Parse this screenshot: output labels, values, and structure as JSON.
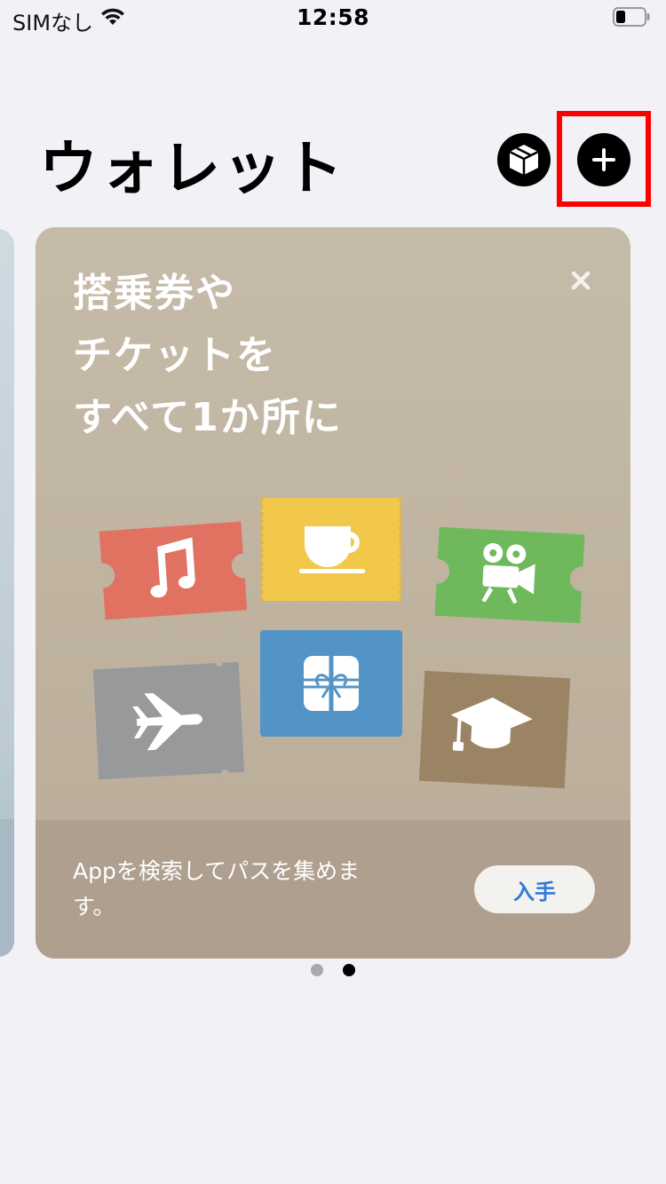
{
  "status_bar": {
    "carrier": "SIMなし",
    "time": "12:58",
    "wifi_icon": "wifi-icon",
    "battery_icon": "battery-low-icon"
  },
  "header": {
    "title": "ウォレット",
    "buttons": [
      {
        "name": "box-button",
        "icon": "package-icon"
      },
      {
        "name": "add-button",
        "icon": "plus-icon",
        "highlighted": true
      }
    ]
  },
  "promo_card": {
    "title": "搭乗券や\nチケットを\nすべて1か所に",
    "close_icon": "close-icon",
    "tickets": [
      {
        "icon": "music-note-icon",
        "color": "#e17261"
      },
      {
        "icon": "coffee-cup-icon",
        "color": "#f2c84b"
      },
      {
        "icon": "movie-camera-icon",
        "color": "#6fb95c"
      },
      {
        "icon": "airplane-icon",
        "color": "#98999b"
      },
      {
        "icon": "gift-icon",
        "color": "#5394c6"
      },
      {
        "icon": "graduation-cap-icon",
        "color": "#9b8463"
      }
    ],
    "footer_text": "Appを検索してパスを集めます。",
    "get_button_label": "入手"
  },
  "page_indicator": {
    "total": 2,
    "current": 2
  },
  "colors": {
    "background": "#f2f1f6",
    "card": "#c4b9a6",
    "card_footer": "#ae9f8f",
    "accent_blue": "#2f7bd6",
    "highlight_red": "#ff0000"
  }
}
